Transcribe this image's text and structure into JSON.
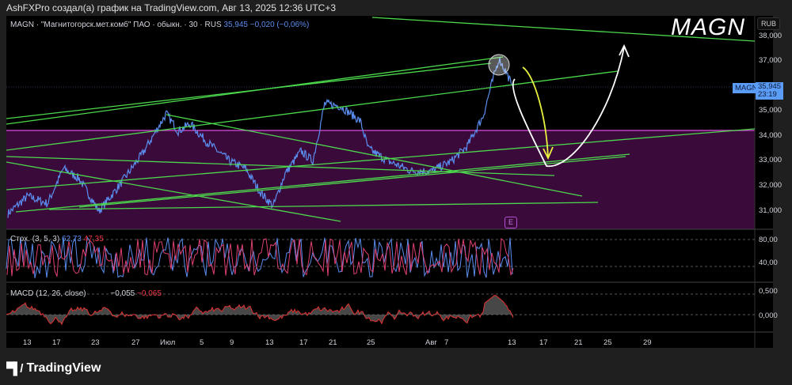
{
  "caption": "AshFXPro создал(а) график на TradingView.com, Авг 13, 2025 12:36 UTC+3",
  "legend": {
    "symbol": "MAGN · \"Магнитогорск.мет.комб\" ПАО · обыкн. · 30 · RUS",
    "price": "35,945",
    "change": "−0,020 (−0,06%)"
  },
  "annotation_text": "MAGN",
  "currency": "RUB",
  "price_tag": {
    "symbol": "MAGN",
    "price": "35,945",
    "countdown": "23:19"
  },
  "price_axis": [
    "38,000",
    "37,000",
    "35,000",
    "34,000",
    "33,000",
    "32,000",
    "31,000"
  ],
  "stoch": {
    "label": "Стох. (3, 5, 3)",
    "k": "62,73",
    "d": "47,35",
    "axis": [
      "80,00",
      "40,00"
    ]
  },
  "macd": {
    "label": "MACD (12, 26, close)",
    "macd": "−0,055",
    "signal": "−0,065",
    "axis": [
      "0,500",
      "0,000"
    ]
  },
  "time_axis": [
    "13",
    "17",
    "23",
    "27",
    "Июл",
    "5",
    "9",
    "13",
    "17",
    "21",
    "25",
    "Авг",
    "7",
    "13",
    "17",
    "21",
    "25",
    "29"
  ],
  "earnings_badge": "E",
  "brand": "TradingView",
  "colors": {
    "line": "#5b8def",
    "trend": "#4cd84c",
    "zone": "#3a0a3a",
    "zone_border": "#c040c0",
    "yellow": "#e8f040"
  }
}
